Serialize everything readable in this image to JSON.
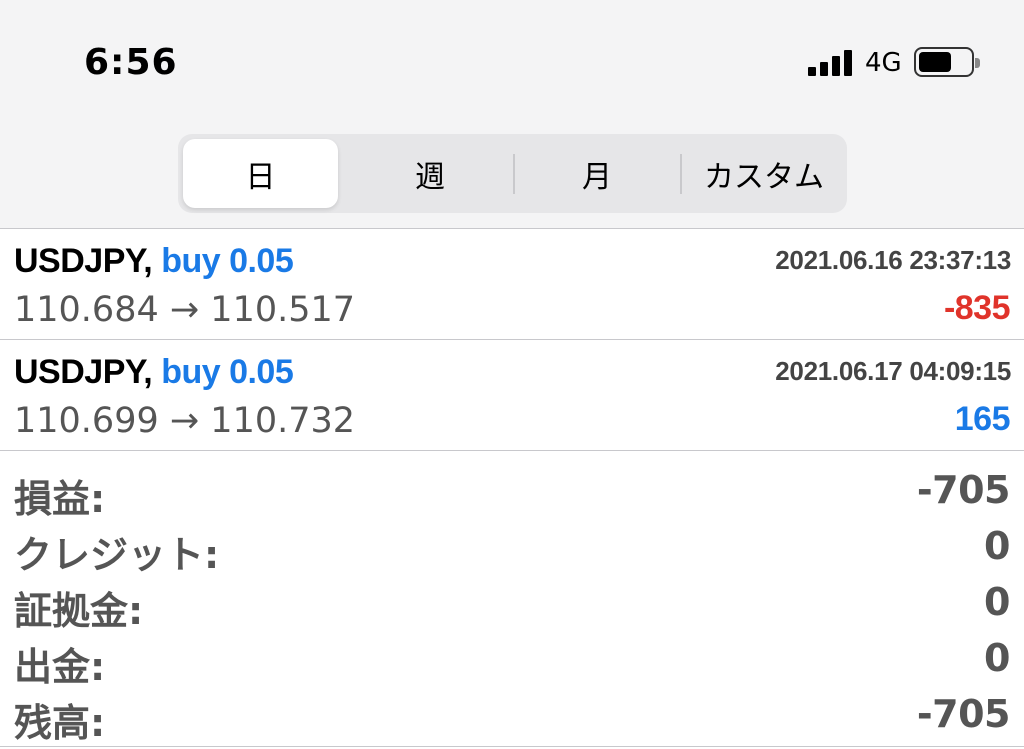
{
  "status_bar": {
    "time": "6:56",
    "network": "4G",
    "signal_icon": "signal-bars-icon",
    "battery_icon": "battery-icon"
  },
  "segmented": {
    "tabs": [
      {
        "label": "日",
        "active": true
      },
      {
        "label": "週",
        "active": false
      },
      {
        "label": "月",
        "active": false
      },
      {
        "label": "カスタム",
        "active": false
      }
    ]
  },
  "deals": [
    {
      "symbol": "USDJPY,",
      "type": "buy 0.05",
      "datetime": "2021.06.16 23:37:13",
      "prices": "110.684 → 110.517",
      "profit": "-835",
      "profit_color": "#e0332a"
    },
    {
      "symbol": "USDJPY,",
      "type": "buy 0.05",
      "datetime": "2021.06.17 04:09:15",
      "prices": "110.699 → 110.732",
      "profit": "165",
      "profit_color": "#1a7ae6"
    }
  ],
  "summary": [
    {
      "label": "損益:",
      "value": "-705"
    },
    {
      "label": "クレジット:",
      "value": "0"
    },
    {
      "label": "証拠金:",
      "value": "0"
    },
    {
      "label": "出金:",
      "value": "0"
    },
    {
      "label": "残高:",
      "value": "-705"
    }
  ],
  "colors": {
    "buy": "#1a7ae6",
    "loss": "#e0332a",
    "gain": "#1a7ae6",
    "header_bg": "#f4f4f5"
  }
}
